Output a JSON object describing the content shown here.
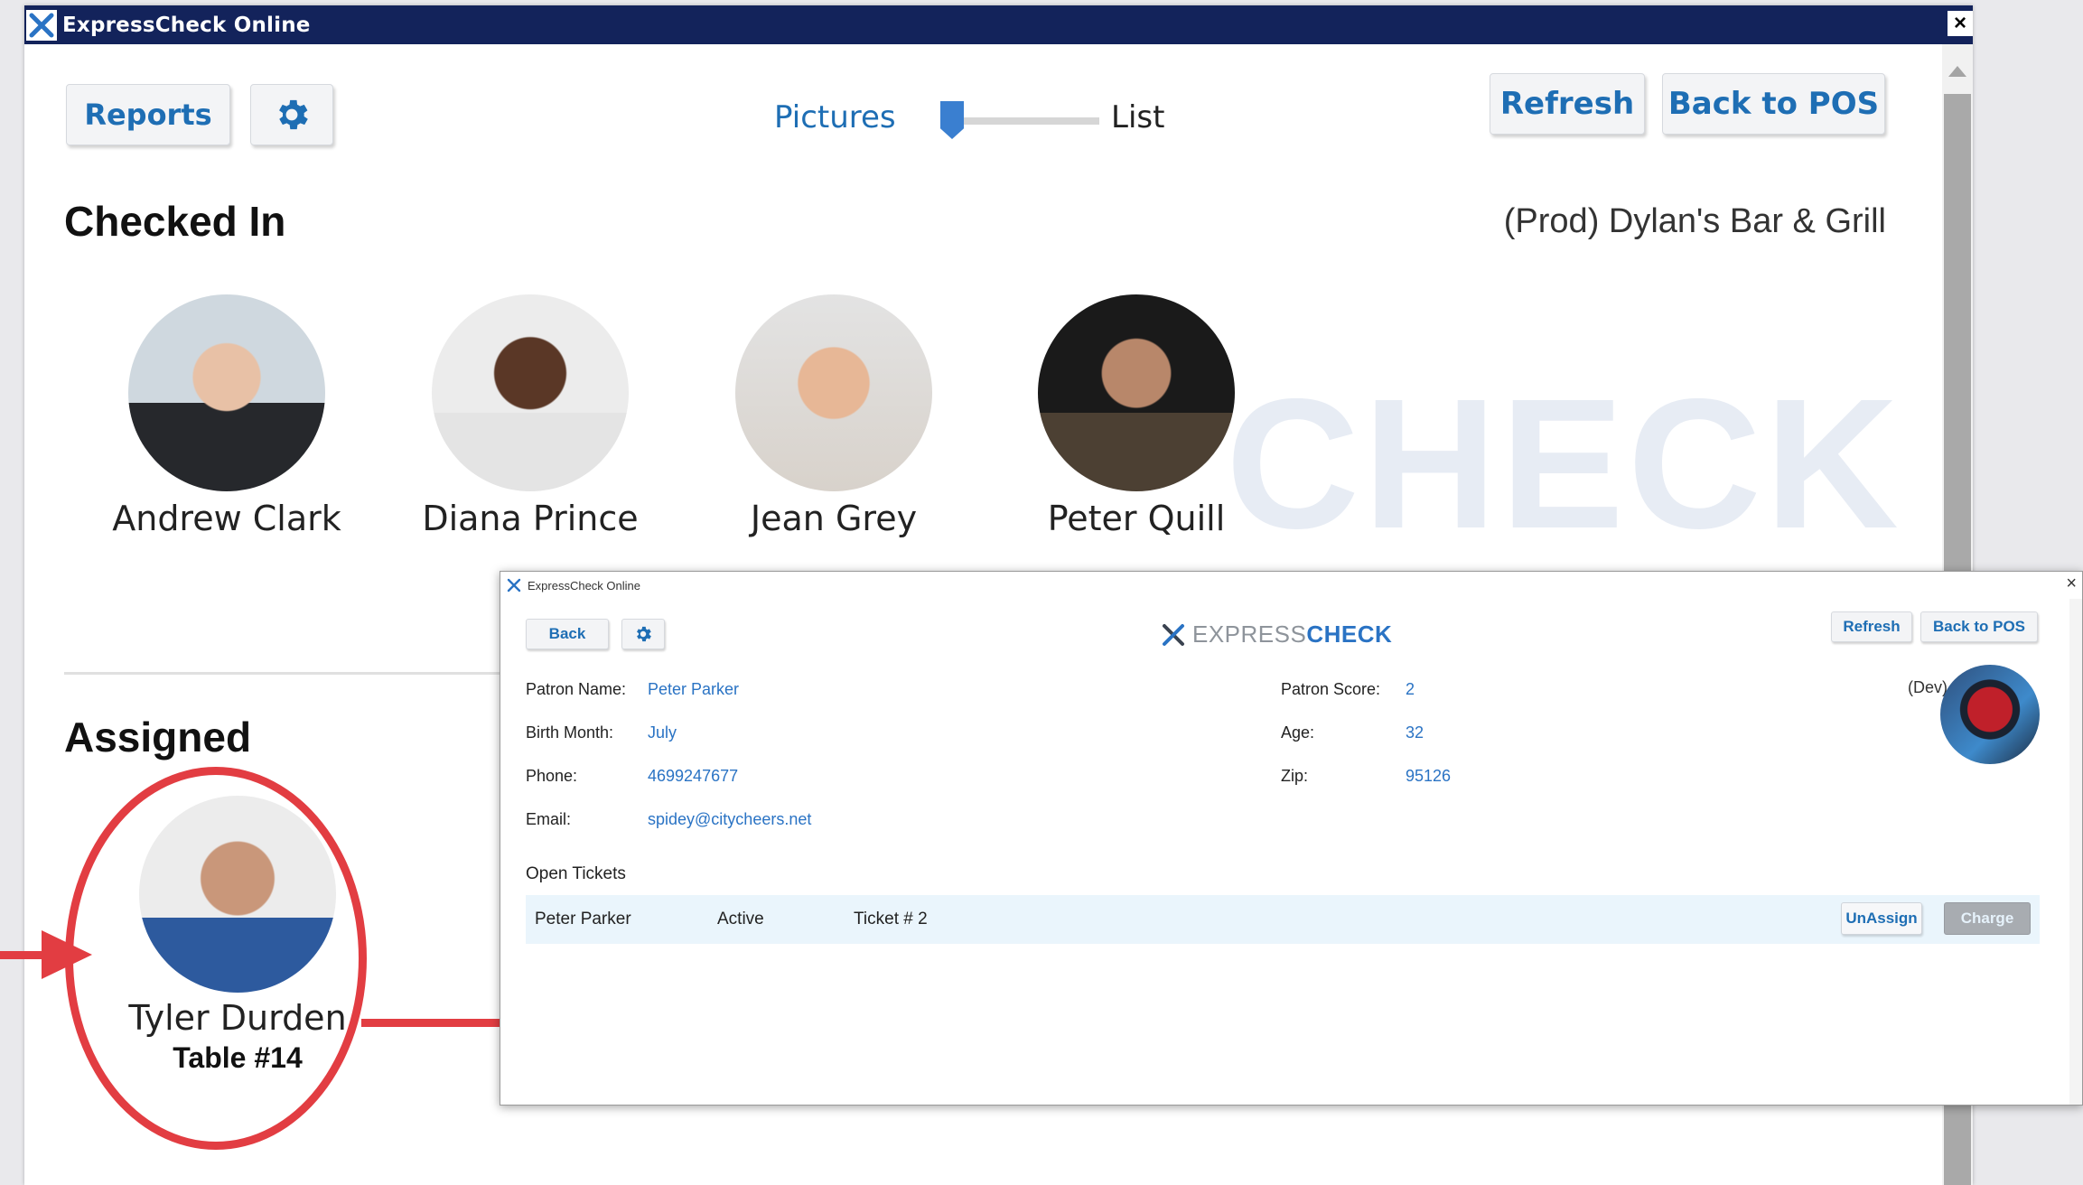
{
  "main_window": {
    "title": "ExpressCheck Online",
    "toolbar": {
      "reports_label": "Reports",
      "settings_icon": "gear-icon",
      "view_left_label": "Pictures",
      "view_right_label": "List",
      "view_slider_position": 0,
      "refresh_label": "Refresh",
      "back_to_pos_label": "Back to POS"
    },
    "checked_in": {
      "heading": "Checked In",
      "venue": "(Prod) Dylan's Bar & Grill",
      "watermark": "CHECK",
      "patrons": [
        {
          "name": "Andrew Clark"
        },
        {
          "name": "Diana Prince"
        },
        {
          "name": "Jean Grey"
        },
        {
          "name": "Peter Quill"
        }
      ]
    },
    "assigned": {
      "heading": "Assigned",
      "patrons": [
        {
          "name": "Tyler Durden",
          "table": "Table #14"
        }
      ]
    }
  },
  "detail_window": {
    "title": "ExpressCheck Online",
    "back_label": "Back",
    "settings_icon": "gear-icon",
    "logo_part1": "EXPRESS",
    "logo_part2": "CHECK",
    "refresh_label": "Refresh",
    "back_to_pos_label": "Back to POS",
    "venue_partial": "(Dev)",
    "fields": {
      "patron_name_label": "Patron Name:",
      "patron_name": "Peter Parker",
      "birth_month_label": "Birth Month:",
      "birth_month": "July",
      "phone_label": "Phone:",
      "phone": "4699247677",
      "email_label": "Email:",
      "email": "spidey@citycheers.net",
      "patron_score_label": "Patron Score:",
      "patron_score": "2",
      "age_label": "Age:",
      "age": "32",
      "zip_label": "Zip:",
      "zip": "95126"
    },
    "open_tickets_label": "Open Tickets",
    "tickets": [
      {
        "patron": "Peter Parker",
        "status": "Active",
        "ticket": "Ticket # 2",
        "unassign_label": "UnAssign",
        "charge_label": "Charge"
      }
    ]
  },
  "colors": {
    "titlebar": "#13235b",
    "accent_blue": "#1e6eb4",
    "annotation_red": "#e23d42",
    "ticket_row_bg": "#eaf5fc"
  }
}
